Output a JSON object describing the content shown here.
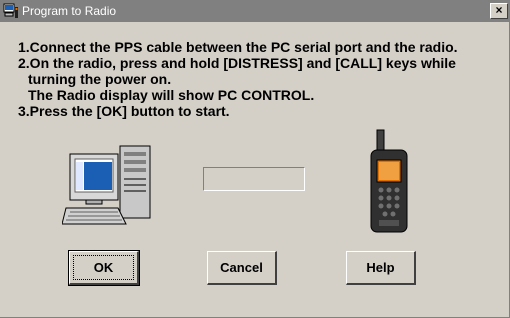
{
  "window": {
    "title": "Program to Radio",
    "close_glyph": "×"
  },
  "instructions": {
    "line1": "1.Connect the PPS cable between the PC serial port and the radio.",
    "line2": "2.On the radio, press and hold [DISTRESS] and [CALL] keys while",
    "line3": "turning the power on.",
    "line4": "The Radio display will show PC CONTROL.",
    "line5": "3.Press the [OK] button to start."
  },
  "progress": {
    "value": 0
  },
  "buttons": {
    "ok": "OK",
    "cancel": "Cancel",
    "help": "Help"
  },
  "icons": {
    "app": "radio-programmer-icon",
    "pc": "computer-icon",
    "radio": "handheld-radio-icon",
    "close": "close-icon"
  },
  "colors": {
    "titlebar": "#808080",
    "face": "#d4d0c8",
    "screen": "#1a5fb4"
  }
}
